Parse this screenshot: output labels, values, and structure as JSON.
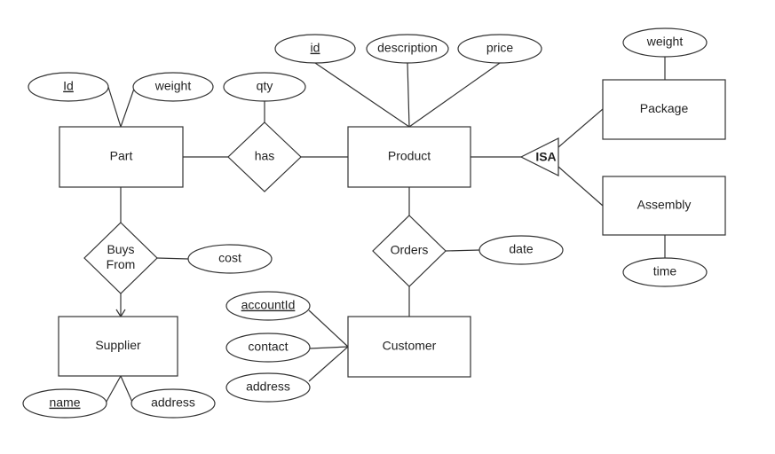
{
  "entities": [
    {
      "id": "part",
      "label": "Part"
    },
    {
      "id": "product",
      "label": "Product"
    },
    {
      "id": "package",
      "label": "Package"
    },
    {
      "id": "assembly",
      "label": "Assembly"
    },
    {
      "id": "customer",
      "label": "Customer"
    },
    {
      "id": "supplier",
      "label": "Supplier"
    }
  ],
  "relationships": [
    {
      "id": "has",
      "label": "has"
    },
    {
      "id": "orders",
      "label": "Orders"
    },
    {
      "id": "buysfrom",
      "label": "Buys From",
      "lines": [
        "Buys",
        "From"
      ]
    }
  ],
  "isa": {
    "id": "isa",
    "label": "ISA",
    "parent": "product",
    "children": [
      "package",
      "assembly"
    ]
  },
  "attributes": [
    {
      "id": "part_id",
      "label": "Id",
      "key": true,
      "of": "part"
    },
    {
      "id": "part_weight",
      "label": "weight",
      "key": false,
      "of": "part"
    },
    {
      "id": "has_qty",
      "label": "qty",
      "key": false,
      "of": "has"
    },
    {
      "id": "product_id",
      "label": "id",
      "key": true,
      "of": "product"
    },
    {
      "id": "product_description",
      "label": "description",
      "key": false,
      "of": "product"
    },
    {
      "id": "product_price",
      "label": "price",
      "key": false,
      "of": "product"
    },
    {
      "id": "package_weight",
      "label": "weight",
      "key": false,
      "of": "package"
    },
    {
      "id": "assembly_time",
      "label": "time",
      "key": false,
      "of": "assembly"
    },
    {
      "id": "orders_date",
      "label": "date",
      "key": false,
      "of": "orders"
    },
    {
      "id": "buys_cost",
      "label": "cost",
      "key": false,
      "of": "buysfrom"
    },
    {
      "id": "customer_accountId",
      "label": "accountId",
      "key": true,
      "of": "customer"
    },
    {
      "id": "customer_contact",
      "label": "contact",
      "key": false,
      "of": "customer"
    },
    {
      "id": "customer_address",
      "label": "address",
      "key": false,
      "of": "customer"
    },
    {
      "id": "supplier_name",
      "label": "name",
      "key": true,
      "of": "supplier"
    },
    {
      "id": "supplier_address",
      "label": "address",
      "key": false,
      "of": "supplier"
    }
  ],
  "links": [
    {
      "from": "part",
      "to": "has"
    },
    {
      "from": "has",
      "to": "product"
    },
    {
      "from": "product",
      "to": "orders"
    },
    {
      "from": "orders",
      "to": "customer"
    },
    {
      "from": "part",
      "to": "buysfrom"
    },
    {
      "from": "buysfrom",
      "to": "supplier",
      "arrow": true
    }
  ]
}
